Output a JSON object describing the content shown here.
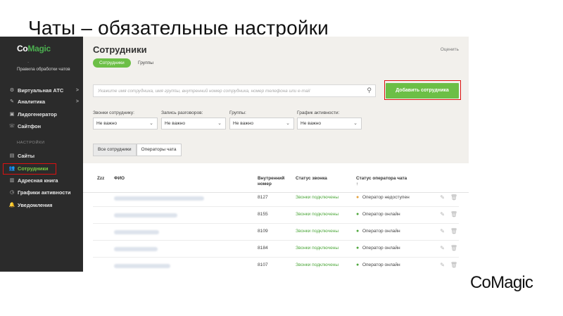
{
  "slide": {
    "title": "Чаты – обязательные настройки",
    "corner_logo": "CoMagic"
  },
  "sidebar": {
    "logo_a": "Co",
    "logo_b": "Magic",
    "dot": ".",
    "rules_text": "Правила обработки чатов",
    "items": [
      {
        "label": "Виртуальная АТС",
        "chevron": ">",
        "icon": "⚙"
      },
      {
        "label": "Аналитика",
        "chevron": ">",
        "icon": "✎"
      },
      {
        "label": "Лидогенератор",
        "icon": "▣"
      },
      {
        "label": "Сайтфон",
        "icon": "☏"
      }
    ],
    "section_label": "НАСТРОЙКИ",
    "settings_items": [
      {
        "label": "Сайты",
        "icon": "▤"
      },
      {
        "label": "Сотрудники",
        "icon": "👥"
      },
      {
        "label": "Адресная книга",
        "icon": "▥"
      },
      {
        "label": "Графики активности",
        "icon": "◷"
      },
      {
        "label": "Уведомления",
        "icon": "🔔"
      }
    ]
  },
  "main": {
    "title": "Сотрудники",
    "rate_link": "Оценить",
    "tabs": [
      {
        "label": "Сотрудники"
      },
      {
        "label": "Группы"
      }
    ],
    "search_placeholder": "Укажите имя сотрудника, имя группы, внутренний номер сотрудника, номер телефона или e-mail",
    "add_button": "Добавить сотрудника",
    "filters": [
      {
        "label": "Звонки сотруднику:",
        "value": "Не важно"
      },
      {
        "label": "Запись разговоров:",
        "value": "Не важно"
      },
      {
        "label": "Группы:",
        "value": "Не важно"
      },
      {
        "label": "График активности:",
        "value": "Не важно"
      }
    ],
    "view_tabs": [
      {
        "label": "Все сотрудники"
      },
      {
        "label": "Операторы чата"
      }
    ],
    "columns": {
      "zzz": "Zzz",
      "name": "ФИО",
      "ext": "Внутренний номер",
      "call_status": "Статус звонка",
      "op_status": "Статус оператора чата",
      "sort_arrow": "↑"
    },
    "rows": [
      {
        "ext": "8127",
        "call": "Звонки подключены",
        "op": "Оператор недоступен",
        "op_state": "busy"
      },
      {
        "ext": "8155",
        "call": "Звонки подключены",
        "op": "Оператор онлайн",
        "op_state": "online"
      },
      {
        "ext": "8109",
        "call": "Звонки подключены",
        "op": "Оператор онлайн",
        "op_state": "online"
      },
      {
        "ext": "8184",
        "call": "Звонки подключены",
        "op": "Оператор онлайн",
        "op_state": "online"
      },
      {
        "ext": "8107",
        "call": "Звонки подключены",
        "op": "Оператор онлайн",
        "op_state": "online"
      }
    ]
  }
}
